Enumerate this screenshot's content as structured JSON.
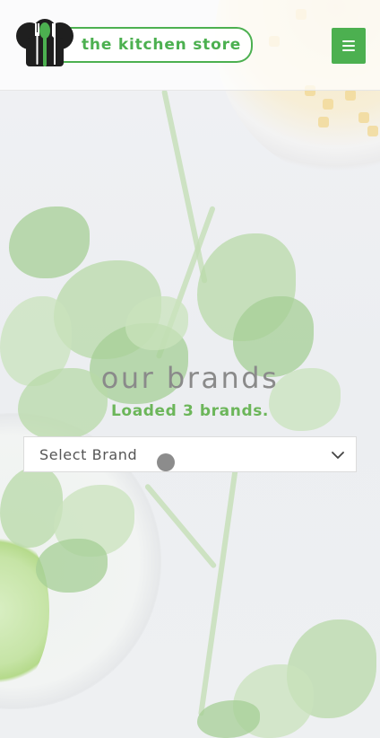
{
  "header": {
    "logo_text": "the kitchen store",
    "menu_icon": "hamburger-icon",
    "brand_color": "#4cb050"
  },
  "main": {
    "title": "our brands",
    "status": "Loaded 3 brands.",
    "brand_select": {
      "selected": "Select Brand",
      "icon": "chevron-down-icon"
    }
  },
  "colors": {
    "accent": "#4cb050",
    "status_text": "#6cb65a",
    "title_text": "#8a8a8a"
  }
}
